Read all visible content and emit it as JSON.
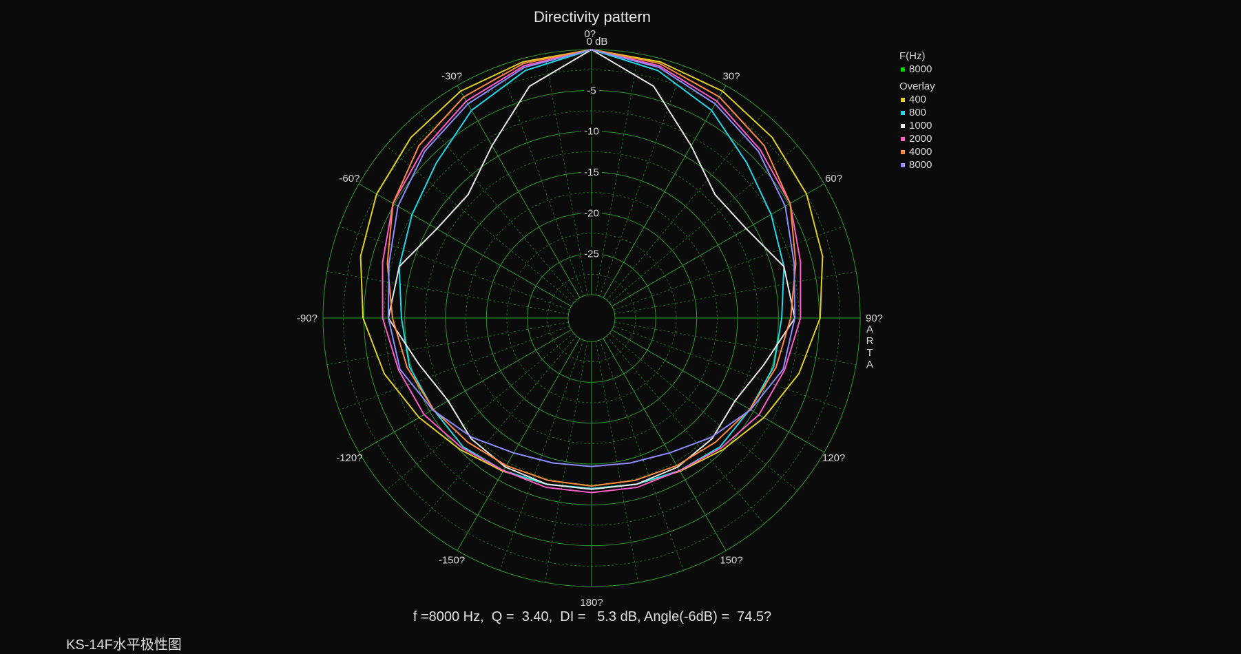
{
  "title": "Directivity pattern",
  "stats_line": "f =8000 Hz,  Q =  3.40,  DI =   5.3 dB, Angle(-6dB) =  74.5?",
  "caption": "KS-14F水平极性图",
  "watermark_letters": [
    "A",
    "R",
    "T",
    "A"
  ],
  "legend": {
    "header": "F(Hz)",
    "current": [
      {
        "label": "8000",
        "color": "#00e000"
      }
    ],
    "overlay_header": "Overlay",
    "overlay": [
      {
        "label": "400",
        "color": "#e0d020"
      },
      {
        "label": "800",
        "color": "#20d8e8"
      },
      {
        "label": "1000",
        "color": "#e8e8e8"
      },
      {
        "label": "2000",
        "color": "#ff5cc8"
      },
      {
        "label": "4000",
        "color": "#ff8a40"
      },
      {
        "label": "8000",
        "color": "#8c8cff"
      }
    ]
  },
  "chart_data": {
    "type": "polar",
    "title": "Directivity pattern",
    "radial_unit": "dB",
    "radial_range": [
      -30,
      0
    ],
    "radial_ticks": [
      0,
      -5,
      -10,
      -15,
      -20,
      -25
    ],
    "radial_tick_labels": [
      "0 dB",
      "-5",
      "-10",
      "-15",
      "-20",
      "-25"
    ],
    "angle_ticks": [
      0,
      30,
      60,
      90,
      120,
      150,
      180,
      -150,
      -120,
      -90,
      -60,
      -30
    ],
    "angle_tick_labels": [
      "0?",
      "30?",
      "60?",
      "90?",
      "120?",
      "150?",
      "180?",
      "-150?",
      "-120?",
      "-90?",
      "-60?",
      "-30?"
    ],
    "angles_deg": [
      0,
      15,
      30,
      45,
      60,
      75,
      90,
      105,
      120,
      135,
      150,
      165,
      180
    ],
    "symmetric": true,
    "series": [
      {
        "name": "400",
        "color": "#e0d020",
        "values": [
          0,
          -0.4,
          -0.8,
          -1.6,
          -2.5,
          -3.6,
          -4.9,
          -6.6,
          -8.5,
          -10.1,
          -11.2,
          -11.8,
          -12.0
        ]
      },
      {
        "name": "800",
        "color": "#20d8e8",
        "values": [
          0,
          -1.5,
          -3.5,
          -6.0,
          -7.5,
          -8.5,
          -9.6,
          -9.8,
          -10.5,
          -10.6,
          -11.3,
          -11.8,
          -12.0
        ]
      },
      {
        "name": "1000",
        "color": "#e8e8e8",
        "values": [
          0,
          -3.5,
          -8.5,
          -11.5,
          -11.0,
          -8.5,
          -8.0,
          -11.0,
          -12.6,
          -12.0,
          -11.8,
          -11.8,
          -11.9
        ]
      },
      {
        "name": "2000",
        "color": "#ff5cc8",
        "values": [
          0,
          -0.9,
          -2.2,
          -3.7,
          -4.8,
          -6.4,
          -7.3,
          -8.4,
          -9.2,
          -10.4,
          -11.3,
          -11.4,
          -11.5
        ]
      },
      {
        "name": "4000",
        "color": "#ff8a40",
        "values": [
          0,
          -0.6,
          -1.6,
          -3.0,
          -4.8,
          -7.0,
          -8.5,
          -9.5,
          -10.5,
          -11.4,
          -12.0,
          -12.3,
          -12.3
        ]
      },
      {
        "name": "8000",
        "color": "#8c8cff",
        "values": [
          0,
          -1.1,
          -2.6,
          -4.0,
          -5.5,
          -7.2,
          -8.0,
          -8.6,
          -10.4,
          -12.2,
          -13.8,
          -14.5,
          -14.7
        ]
      }
    ],
    "grid": true,
    "legend_position": "top-right"
  }
}
